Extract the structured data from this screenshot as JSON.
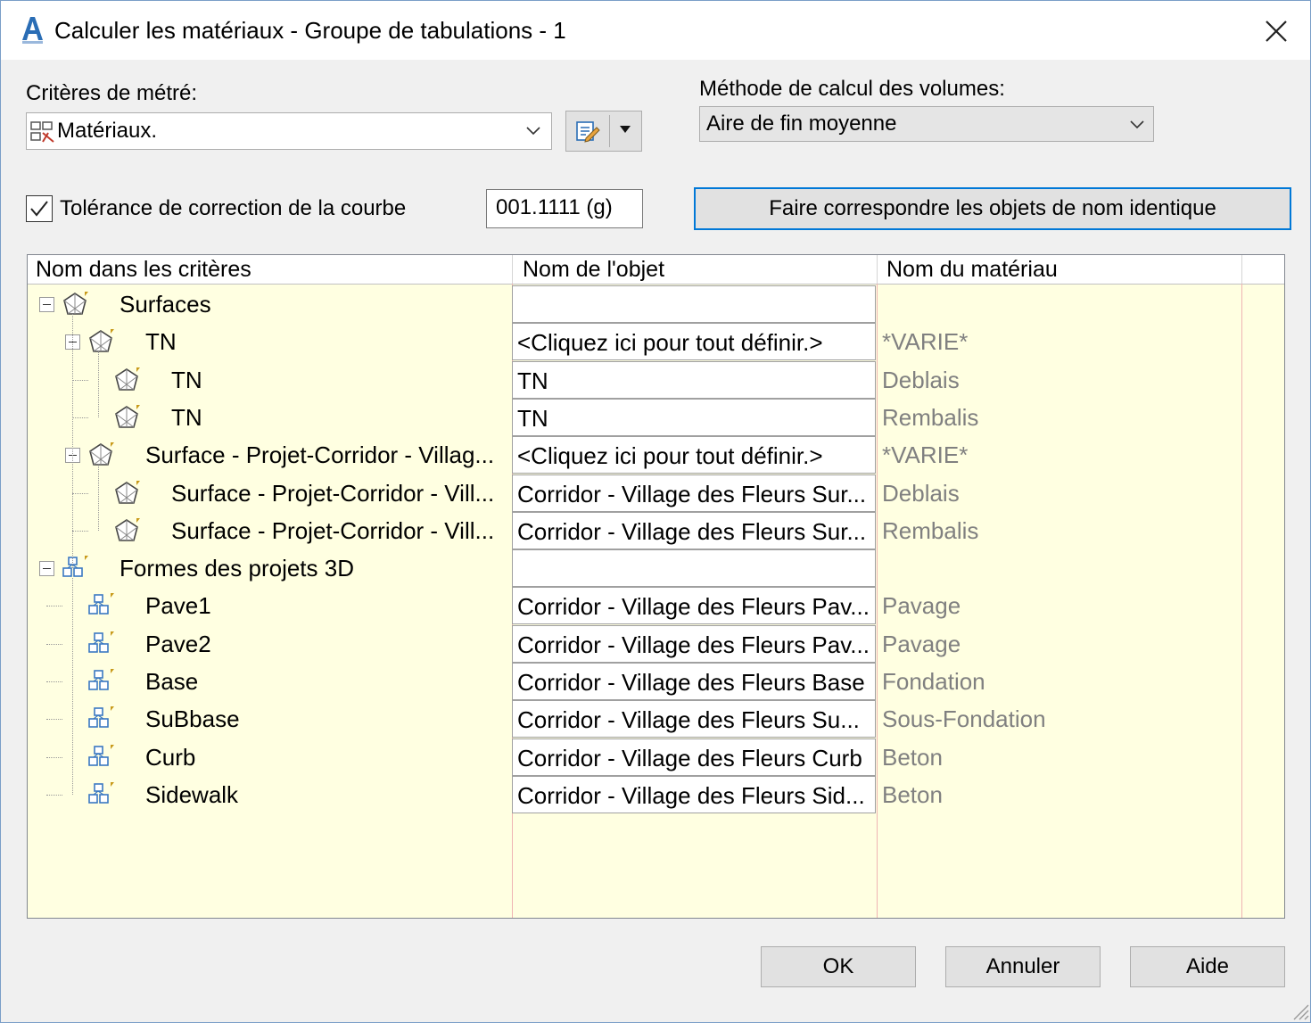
{
  "window": {
    "title": "Calculer les matériaux - Groupe de tabulations - 1",
    "app_icon": "autocad-a-icon",
    "accent": "#0078d7"
  },
  "criteria": {
    "label": "Critères de métré:",
    "value": "Matériaux."
  },
  "volume_method": {
    "label": "Méthode de calcul des volumes:",
    "value": "Aire de fin moyenne"
  },
  "tolerance": {
    "checked": true,
    "label": "Tolérance de correction de la courbe",
    "value": "001.1111 (g)"
  },
  "match_button": "Faire correspondre les objets de nom identique",
  "grid": {
    "columns": [
      "Nom dans les critères",
      "Nom de l'objet",
      "Nom du matériau"
    ],
    "rows": [
      {
        "name": "Surfaces",
        "object": "",
        "material": "",
        "level": 0,
        "kind": "surface",
        "expand": true,
        "cell": true
      },
      {
        "name": "TN",
        "object": "<Cliquez ici pour tout définir.>",
        "material": "*VARIE*",
        "level": 1,
        "kind": "surface",
        "expand": true,
        "cell": true
      },
      {
        "name": "TN",
        "object": "TN",
        "material": "Deblais",
        "level": 2,
        "kind": "surface",
        "expand": false,
        "cell": true
      },
      {
        "name": "TN",
        "object": "TN",
        "material": "Rembalis",
        "level": 2,
        "kind": "surface",
        "expand": false,
        "cell": true
      },
      {
        "name": "Surface - Projet-Corridor - Villag...",
        "object": "<Cliquez ici pour tout définir.>",
        "material": "*VARIE*",
        "level": 1,
        "kind": "surface",
        "expand": true,
        "cell": true
      },
      {
        "name": "Surface - Projet-Corridor - Vill...",
        "object": "Corridor - Village des Fleurs Sur...",
        "material": "Deblais",
        "level": 2,
        "kind": "surface",
        "expand": false,
        "cell": true
      },
      {
        "name": "Surface - Projet-Corridor - Vill...",
        "object": "Corridor - Village des Fleurs Sur...",
        "material": "Rembalis",
        "level": 2,
        "kind": "surface",
        "expand": false,
        "cell": true
      },
      {
        "name": "Formes des projets 3D",
        "object": "",
        "material": "",
        "level": 0,
        "kind": "shape",
        "expand": true,
        "cell": true
      },
      {
        "name": "Pave1",
        "object": "Corridor - Village des Fleurs Pav...",
        "material": "Pavage",
        "level": 1,
        "kind": "shape",
        "expand": false,
        "cell": true
      },
      {
        "name": "Pave2",
        "object": "Corridor - Village des Fleurs Pav...",
        "material": "Pavage",
        "level": 1,
        "kind": "shape",
        "expand": false,
        "cell": true
      },
      {
        "name": "Base",
        "object": "Corridor - Village des Fleurs Base",
        "material": "Fondation",
        "level": 1,
        "kind": "shape",
        "expand": false,
        "cell": true
      },
      {
        "name": "SuBbase",
        "object": "Corridor - Village des Fleurs Su...",
        "material": "Sous-Fondation",
        "level": 1,
        "kind": "shape",
        "expand": false,
        "cell": true
      },
      {
        "name": "Curb",
        "object": "Corridor - Village des Fleurs Curb",
        "material": "Beton",
        "level": 1,
        "kind": "shape",
        "expand": false,
        "cell": true
      },
      {
        "name": "Sidewalk",
        "object": "Corridor - Village des Fleurs Sid...",
        "material": "Beton",
        "level": 1,
        "kind": "shape",
        "expand": false,
        "cell": true
      }
    ]
  },
  "buttons": {
    "ok": "OK",
    "cancel": "Annuler",
    "help": "Aide"
  }
}
